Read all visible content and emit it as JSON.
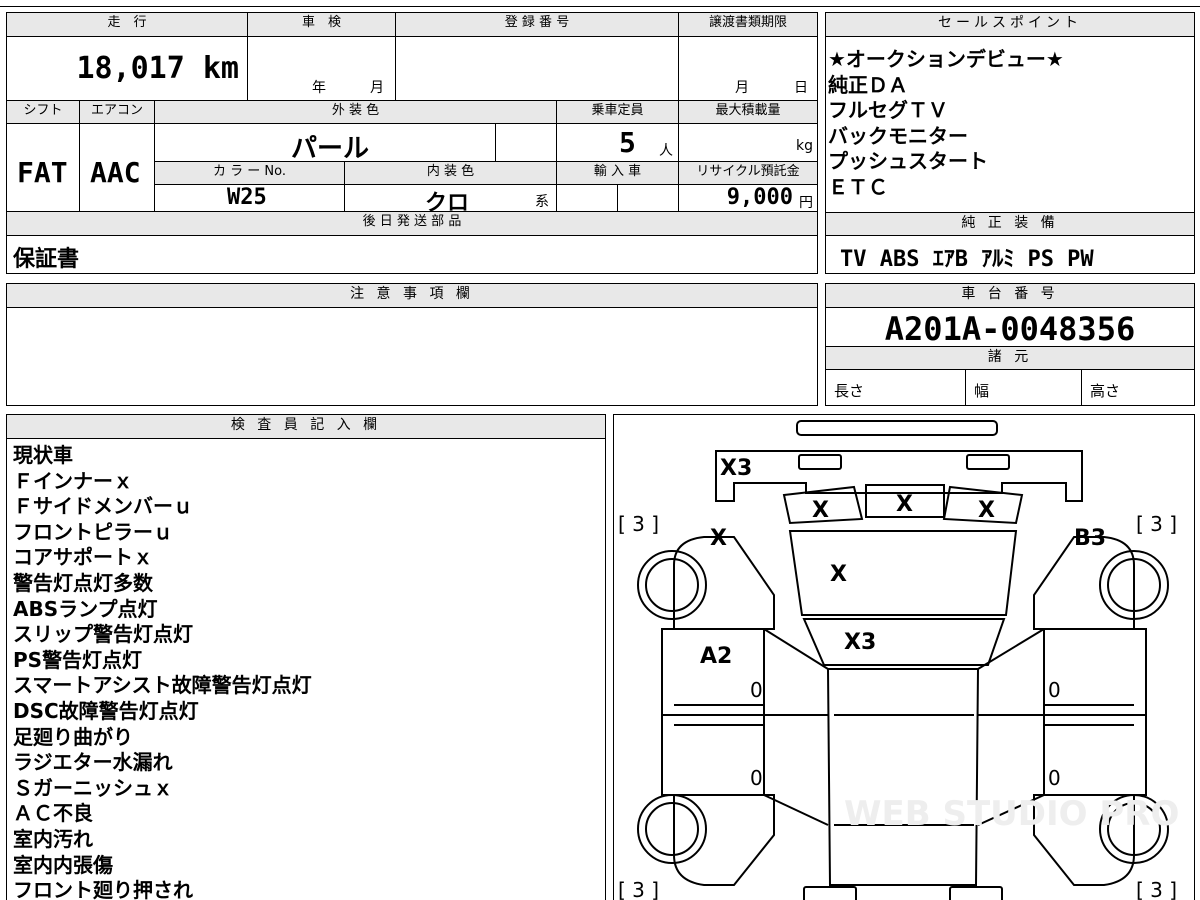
{
  "headers": {
    "mileage": "走　行",
    "inspection": "車　検",
    "registration": "登 録 番 号",
    "transfer_deadline": "譲渡書類期限",
    "sales_points": "セールスポイント",
    "shift": "シフト",
    "aircon": "エアコン",
    "exterior_color": "外 装 色",
    "capacity": "乗車定員",
    "max_load": "最大積載量",
    "color_no": "カ ラ ー No.",
    "interior_color": "内 装 色",
    "import": "輸 入 車",
    "recycle_fee": "リサイクル預託金",
    "later_parts": "後 日 発 送 部 品",
    "equipment": "純 正 装 備",
    "notes": "注 意 事 項 欄",
    "chassis_no": "車 台 番 号",
    "specs": "諸 元",
    "inspector": "検 査 員 記 入 欄"
  },
  "values": {
    "mileage": "18,017 km",
    "inspection_year_unit": "年",
    "inspection_month_unit": "月",
    "transfer_month_unit": "月",
    "transfer_day_unit": "日",
    "shift": "FAT",
    "aircon": "AAC",
    "exterior_color": "パール",
    "capacity": "5",
    "capacity_unit": "人",
    "max_load_unit": "kg",
    "color_no": "W25",
    "interior_color": "クロ",
    "interior_suffix": "系",
    "recycle_fee": "9,000",
    "recycle_unit": "円",
    "later_parts": "保証書",
    "equipment": "TV ABS ｴｱB ｱﾙﾐ PS PW",
    "chassis_no": "A201A-0048356",
    "length_label": "長さ",
    "width_label": "幅",
    "height_label": "高さ"
  },
  "sales_points": [
    "★オークションデビュー★",
    "純正ＤＡ",
    "フルセグＴＶ",
    "バックモニター",
    "プッシュスタート",
    "ＥＴＣ"
  ],
  "inspector_notes": [
    "現状車",
    "Ｆインナーｘ",
    "Ｆサイドメンバーｕ",
    "フロントピラーｕ",
    "コアサポートｘ",
    "警告灯点灯多数",
    "ABSランプ点灯",
    "スリップ警告灯点灯",
    "PS警告灯点灯",
    "スマートアシスト故障警告灯点灯",
    "DSC故障警告灯点灯",
    "足廻り曲がり",
    "ラジエター水漏れ",
    "Ｓガーニッシュｘ",
    "ＡＣ不良",
    "室内汚れ",
    "室内内張傷",
    "フロント廻り押され"
  ],
  "diagram_marks": {
    "front_bumper": "X3",
    "tire_bracket": "[ 3 ]",
    "tire_fl": "[ 3 ]",
    "tire_fr": "[ 3 ]",
    "tire_rl": "[ 3 ]",
    "tire_rr": "[ 3 ]",
    "headlight_l": "X",
    "grille": "X",
    "headlight_r": "X",
    "fender_l": "X",
    "fender_r": "B3",
    "hood": "X",
    "windshield": "X3",
    "front_door_l": "A2",
    "door_zero_1": "0",
    "door_zero_2": "0",
    "door_zero_3": "0",
    "door_zero_4": "0"
  },
  "watermark": "WEB STUDIO PRO"
}
